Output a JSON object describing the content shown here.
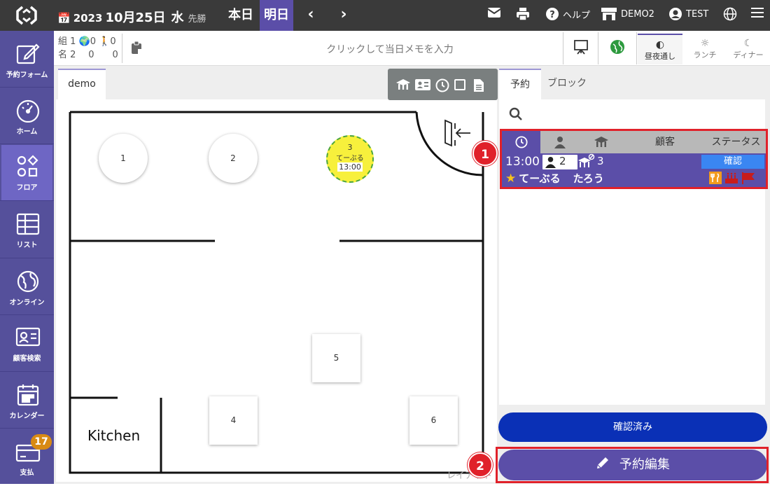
{
  "topbar": {
    "date_year": "2023",
    "date_month_day": "10月25日",
    "date_weekday": "水",
    "date_rokuyo": "先勝",
    "today_label": "本日",
    "tomorrow_label": "明日",
    "help_label": "ヘルプ",
    "store_label": "DEMO2",
    "user_label": "TEST"
  },
  "sidebar": {
    "items": [
      {
        "label": "予約フォーム",
        "icon": "edit-icon"
      },
      {
        "label": "ホーム",
        "icon": "gauge-icon"
      },
      {
        "label": "フロア",
        "icon": "shapes-icon"
      },
      {
        "label": "リスト",
        "icon": "table-icon"
      },
      {
        "label": "オンライン",
        "icon": "globe-icon"
      },
      {
        "label": "顧客検索",
        "icon": "contact-card-icon"
      },
      {
        "label": "カレンダー",
        "icon": "calendar-icon"
      },
      {
        "label": "支払",
        "icon": "card-icon",
        "badge": "17"
      }
    ]
  },
  "stats": {
    "row1": "組 1 🌍 0 🚶 0",
    "row2": "名 2     0     0",
    "groups_label": "組",
    "groups_total": "1",
    "groups_online": "0",
    "groups_walkin": "0",
    "people_label": "名",
    "people_total": "2",
    "people_online": "0",
    "people_walkin": "0"
  },
  "memo_placeholder": "クリックして当日メモを入力",
  "modes": [
    {
      "label": "昼夜通し",
      "icon": "half-circle-icon"
    },
    {
      "label": "ランチ",
      "icon": "sun-icon"
    },
    {
      "label": "ディナー",
      "icon": "moon-icon"
    }
  ],
  "floor": {
    "tab_label": "demo",
    "tables": [
      {
        "id": "1",
        "shape": "round"
      },
      {
        "id": "2",
        "shape": "round"
      },
      {
        "id": "3",
        "shape": "round",
        "name": "てーぶる",
        "time": "13:00",
        "highlight": "#f7f03c"
      },
      {
        "id": "4",
        "shape": "square"
      },
      {
        "id": "5",
        "shape": "square"
      },
      {
        "id": "6",
        "shape": "square"
      }
    ],
    "kitchen_label": "Kitchen",
    "layout_label": "レイアウト"
  },
  "right_panel": {
    "tabs": [
      "予約",
      "ブロック"
    ],
    "columns": {
      "customer": "顧客",
      "status": "ステータス"
    },
    "reservation": {
      "time": "13:00",
      "people": "2",
      "table": "3",
      "status": "確認",
      "name": "てーぶる",
      "name_given": "たろう"
    },
    "confirmed_button": "確認済み",
    "edit_button": "予約編集"
  },
  "markers": [
    "1",
    "2"
  ],
  "colors": {
    "primary": "#5b4ea8",
    "sidebar": "#55509b",
    "confirmed": "#0a30b6",
    "status_blue": "#3a86f2",
    "highlight_red": "#e0212a",
    "topbar": "#3a3a3a"
  }
}
